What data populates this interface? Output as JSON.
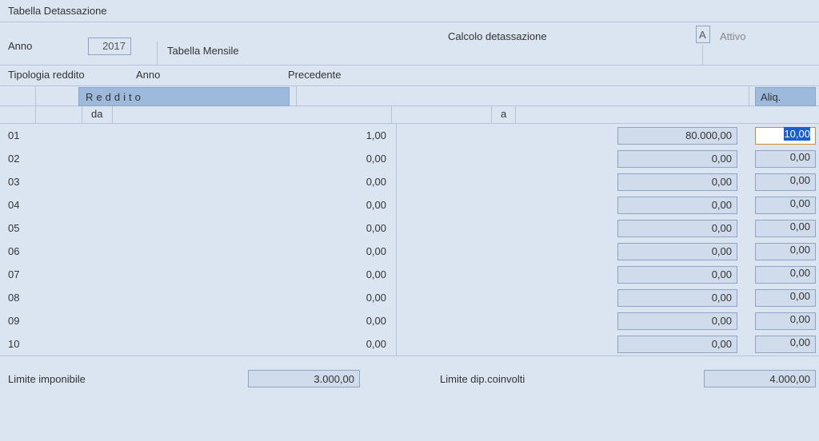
{
  "title": "Tabella Detassazione",
  "header": {
    "anno_label": "Anno",
    "anno_value": "2017",
    "tab_monthly": "Tabella Mensile",
    "calc_label": "Calcolo detassazione",
    "calc_code": "A",
    "calc_status": "Attivo"
  },
  "subhead": {
    "tipologia": "Tipologia reddito",
    "anno": "Anno",
    "precedente": "Precedente"
  },
  "bands": {
    "reddito": "Reddito",
    "aliq": "Aliq."
  },
  "da_a": {
    "da": "da",
    "a": "a"
  },
  "rows": [
    {
      "n": "01",
      "da": "1,00",
      "a": "80.000,00",
      "aliq": "10,00",
      "active": true
    },
    {
      "n": "02",
      "da": "0,00",
      "a": "0,00",
      "aliq": "0,00",
      "active": false
    },
    {
      "n": "03",
      "da": "0,00",
      "a": "0,00",
      "aliq": "0,00",
      "active": false
    },
    {
      "n": "04",
      "da": "0,00",
      "a": "0,00",
      "aliq": "0,00",
      "active": false
    },
    {
      "n": "05",
      "da": "0,00",
      "a": "0,00",
      "aliq": "0,00",
      "active": false
    },
    {
      "n": "06",
      "da": "0,00",
      "a": "0,00",
      "aliq": "0,00",
      "active": false
    },
    {
      "n": "07",
      "da": "0,00",
      "a": "0,00",
      "aliq": "0,00",
      "active": false
    },
    {
      "n": "08",
      "da": "0,00",
      "a": "0,00",
      "aliq": "0,00",
      "active": false
    },
    {
      "n": "09",
      "da": "0,00",
      "a": "0,00",
      "aliq": "0,00",
      "active": false
    },
    {
      "n": "10",
      "da": "0,00",
      "a": "0,00",
      "aliq": "0,00",
      "active": false
    }
  ],
  "footer": {
    "lim_imp_label": "Limite imponibile",
    "lim_imp_value": "3.000,00",
    "lim_dip_label": "Limite dip.coinvolti",
    "lim_dip_value": "4.000,00"
  }
}
